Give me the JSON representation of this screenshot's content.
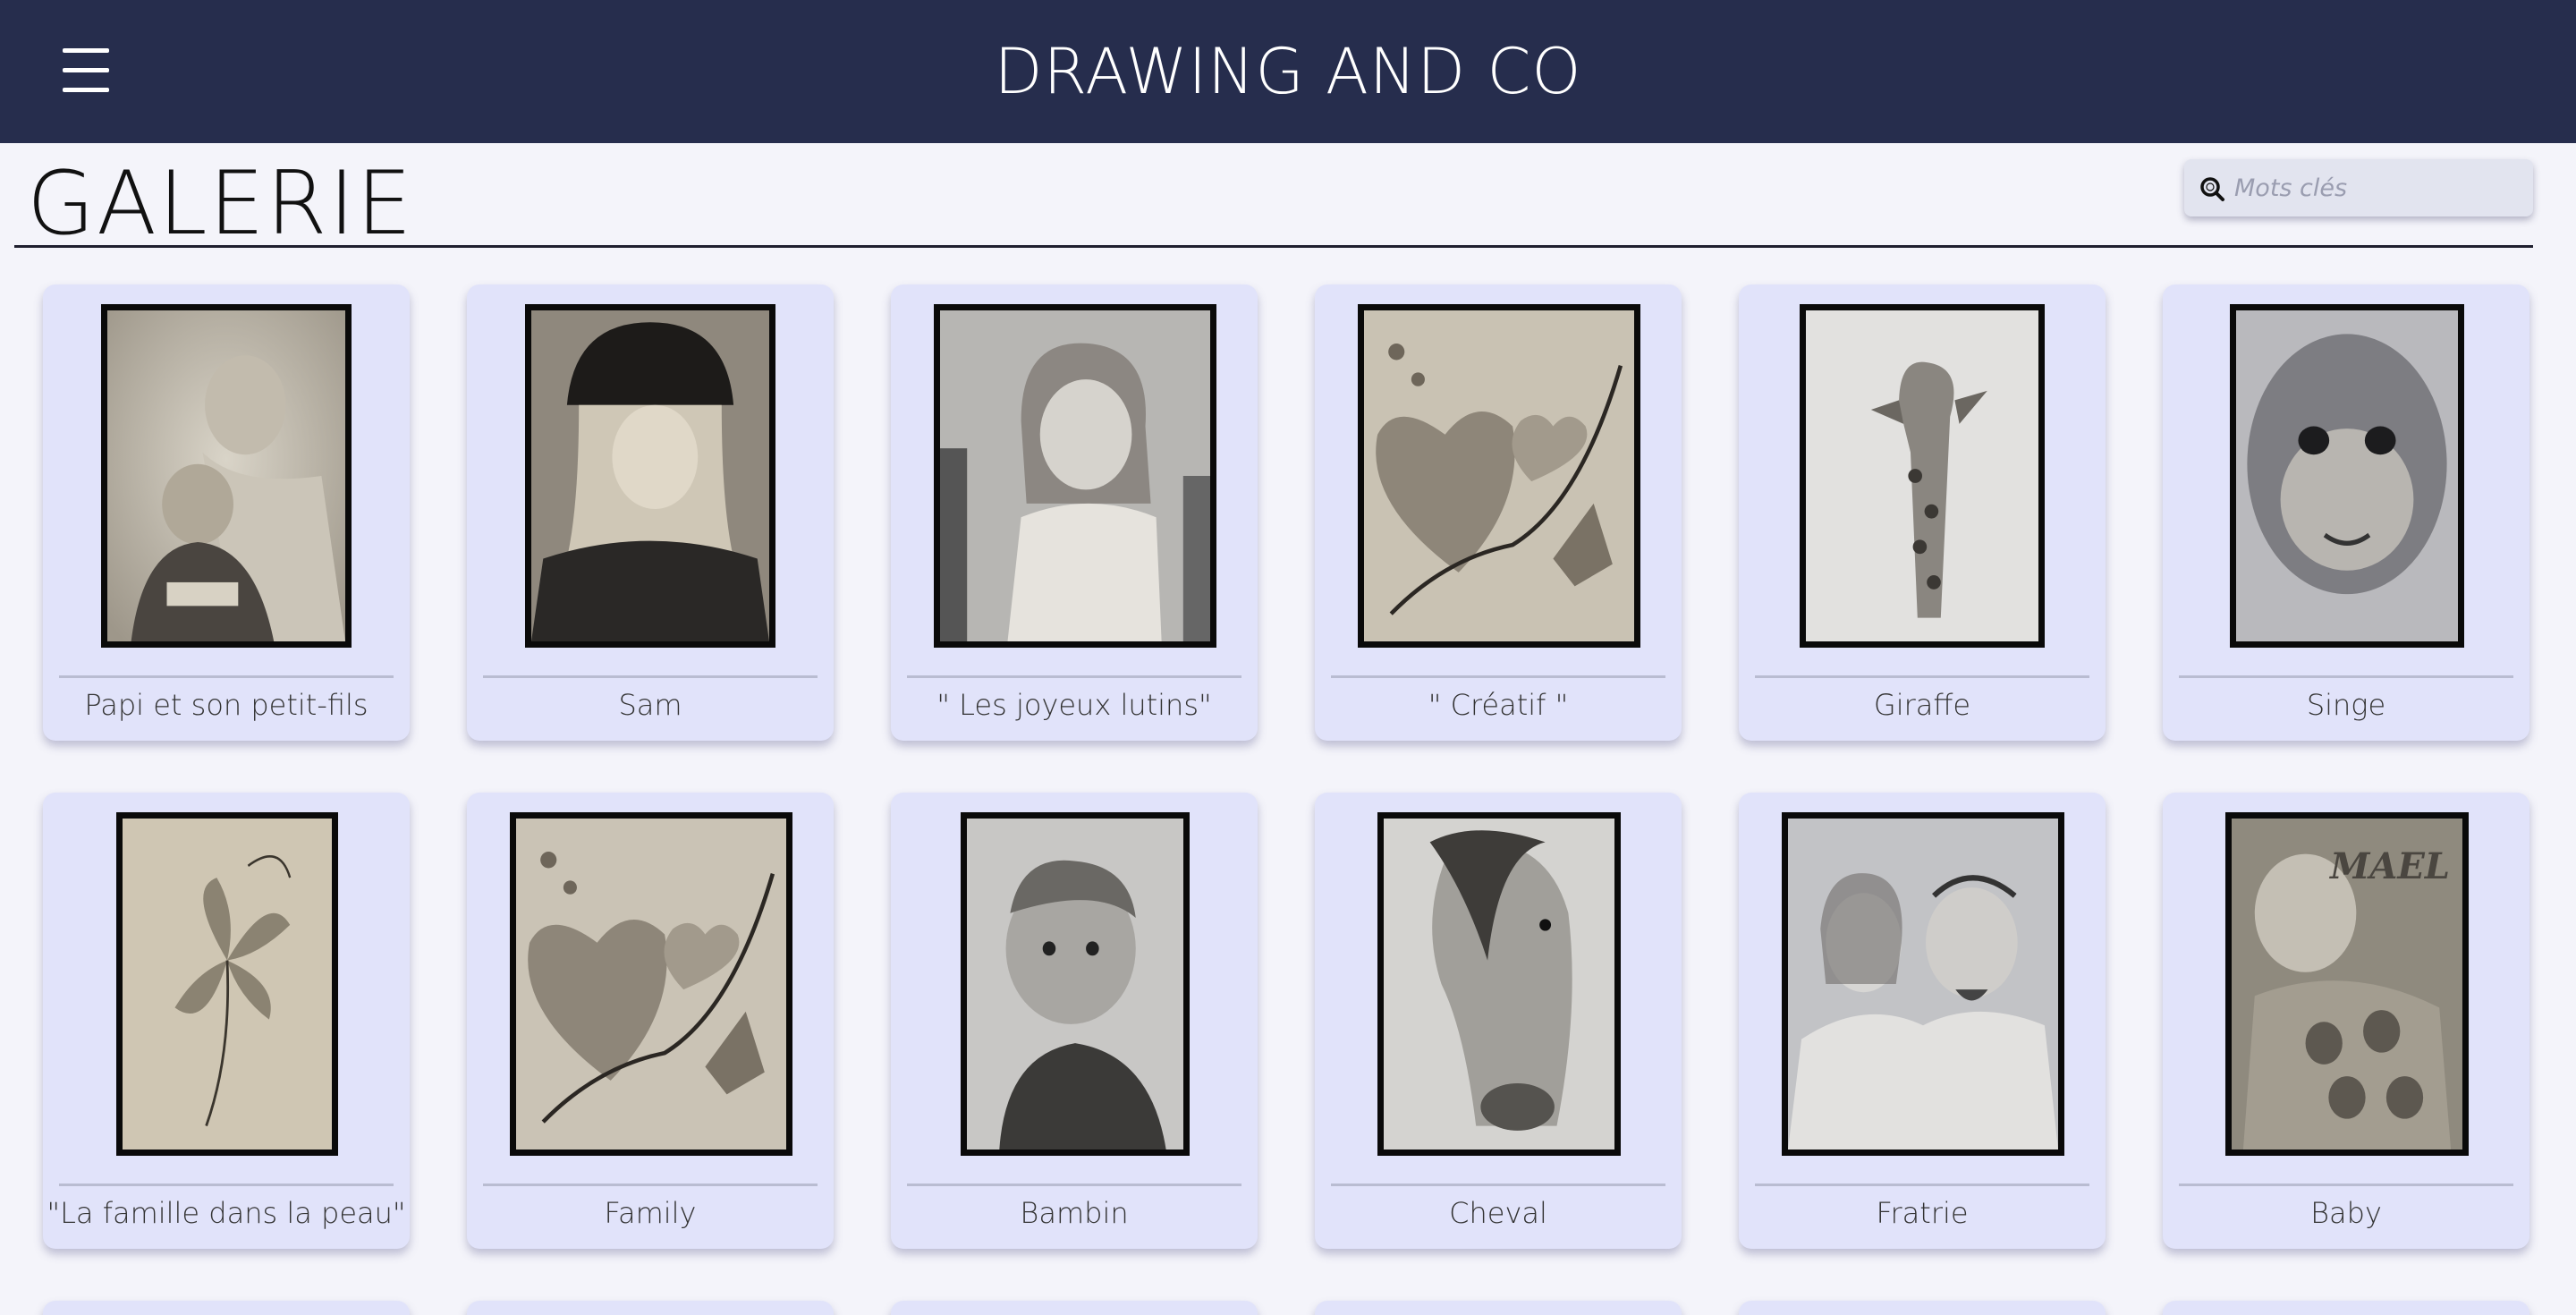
{
  "header": {
    "site_title": "DRAWING AND CO",
    "menu_icon": "hamburger-menu-icon",
    "background_color": "#262d4d"
  },
  "page": {
    "title": "GALERIE"
  },
  "search": {
    "placeholder": "Mots clés",
    "value": "",
    "icon": "search-icon"
  },
  "gallery": {
    "items": [
      {
        "label": "Papi et son petit-fils",
        "subject": "grandfather and grandson portrait"
      },
      {
        "label": "Sam",
        "subject": "woman with beanie portrait"
      },
      {
        "label": "\" Les joyeux lutins\"",
        "subject": "little girl portrait"
      },
      {
        "label": "\" Créatif \"",
        "subject": "hearts and lily flowers"
      },
      {
        "label": "Giraffe",
        "subject": "giraffe head"
      },
      {
        "label": "Singe",
        "subject": "baby monkey face"
      },
      {
        "label": "\"La famille dans la peau\"",
        "subject": "lily flower tattoo design"
      },
      {
        "label": "Family",
        "subject": "hearts and lily flowers"
      },
      {
        "label": "Bambin",
        "subject": "baby portrait"
      },
      {
        "label": "Cheval",
        "subject": "horse head"
      },
      {
        "label": "Fratrie",
        "subject": "man and woman portrait"
      },
      {
        "label": "Baby",
        "subject": "baby with owl shirt",
        "inscription": "MAEL"
      }
    ]
  },
  "colors": {
    "card_background": "#e1e3fa",
    "page_background": "#f4f4fa"
  }
}
